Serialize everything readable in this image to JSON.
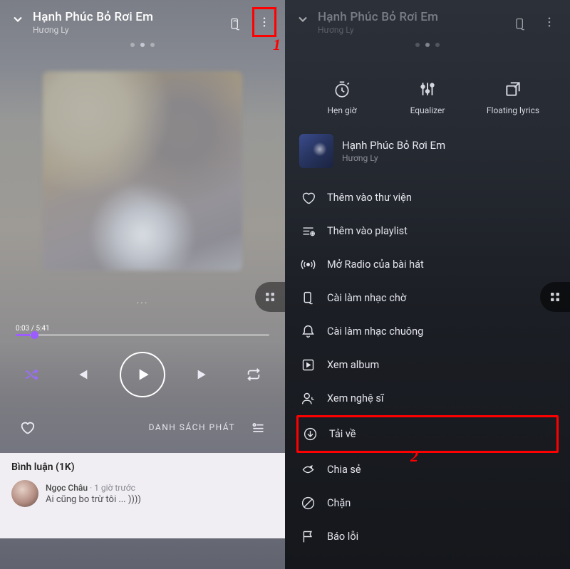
{
  "left": {
    "song_title": "Hạnh Phúc Bỏ Rơi Em",
    "artist": "Hương Ly",
    "annot1": "1",
    "lyrics_placeholder": "...",
    "progress": {
      "current": "0:03",
      "total": "5:41"
    },
    "playlist_label": "DANH SÁCH PHÁT",
    "comments": {
      "title": "Bình luận (1K)",
      "items": [
        {
          "user": "Ngọc Châu",
          "time": "1 giờ trước",
          "text": "Ai cũng bo trừ tôi ... ))))"
        }
      ]
    }
  },
  "right": {
    "song_title": "Hạnh Phúc Bỏ Rơi Em",
    "artist": "Hương Ly",
    "top": [
      {
        "label": "Hẹn giờ"
      },
      {
        "label": "Equalizer"
      },
      {
        "label": "Floating lyrics"
      }
    ],
    "mini": {
      "title": "Hạnh Phúc Bỏ Rơi Em",
      "artist": "Hương Ly"
    },
    "menu": [
      "Thêm vào thư viện",
      "Thêm vào playlist",
      "Mở Radio của bài hát",
      "Cài làm nhạc chờ",
      "Cài làm nhạc chuông",
      "Xem album",
      "Xem nghệ sĩ",
      "Tải về",
      "Chia sẻ",
      "Chặn",
      "Báo lỗi"
    ],
    "annot2": "2"
  }
}
